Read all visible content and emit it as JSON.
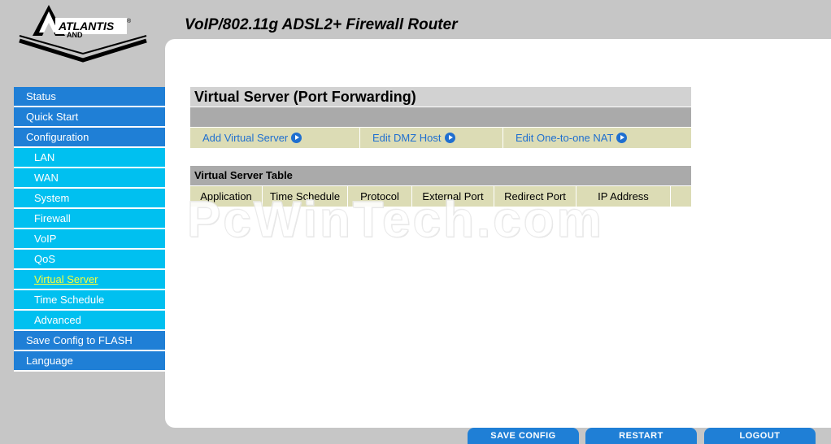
{
  "header": {
    "logo_text": "ATLANTIS LAND",
    "product_title": "VoIP/802.11g ADSL2+ Firewall Router"
  },
  "sidebar": {
    "items": [
      {
        "label": "Status",
        "level": "top"
      },
      {
        "label": "Quick Start",
        "level": "top"
      },
      {
        "label": "Configuration",
        "level": "top"
      },
      {
        "label": "LAN",
        "level": "sub"
      },
      {
        "label": "WAN",
        "level": "sub"
      },
      {
        "label": "System",
        "level": "sub"
      },
      {
        "label": "Firewall",
        "level": "sub"
      },
      {
        "label": "VoIP",
        "level": "sub"
      },
      {
        "label": "QoS",
        "level": "sub"
      },
      {
        "label": "Virtual Server",
        "level": "sub",
        "active": true
      },
      {
        "label": "Time Schedule",
        "level": "sub"
      },
      {
        "label": "Advanced",
        "level": "sub"
      },
      {
        "label": "Save Config to FLASH",
        "level": "top"
      },
      {
        "label": "Language",
        "level": "top"
      }
    ]
  },
  "main": {
    "section_title": "Virtual Server (Port Forwarding)",
    "actions": {
      "add_virtual_server": "Add Virtual Server",
      "edit_dmz_host": "Edit DMZ Host",
      "edit_one_to_one_nat": "Edit One-to-one NAT"
    },
    "table": {
      "title": "Virtual Server Table",
      "columns": [
        "Application",
        "Time Schedule",
        "Protocol",
        "External Port",
        "Redirect Port",
        "IP Address",
        ""
      ]
    }
  },
  "watermark": "PcWinTech.com",
  "footer": {
    "save_config": "SAVE CONFIG",
    "restart": "RESTART",
    "logout": "LOGOUT"
  },
  "colors": {
    "nav_top": "#1f7fd6",
    "nav_sub": "#00c0f0",
    "nav_active_text": "#f8ff38",
    "link": "#1f6fd0",
    "row_bg": "#dcdcb5",
    "bar_bg": "#aaaaaa"
  }
}
